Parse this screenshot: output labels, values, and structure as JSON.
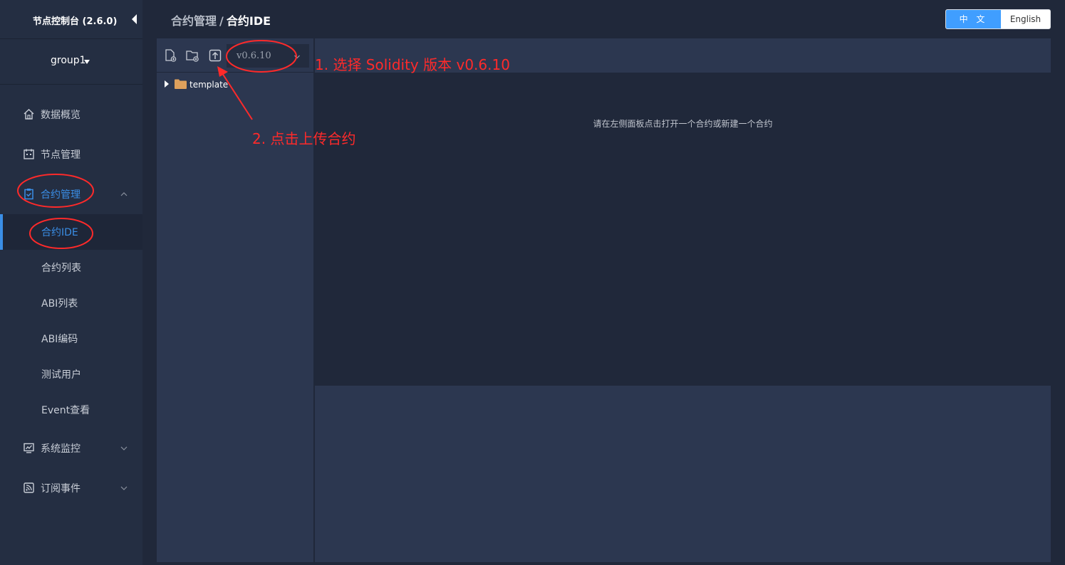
{
  "sidebar": {
    "brand_title": "节点控制台 (2.6.0)",
    "group_label": "group1",
    "menu": {
      "overview": "数据概览",
      "node": "节点管理",
      "contract": "合约管理",
      "monitor": "系统监控",
      "subscribe": "订阅事件"
    },
    "submenu": {
      "ide": "合约IDE",
      "list": "合约列表",
      "abi_list": "ABI列表",
      "abi_encode": "ABI编码",
      "test_user": "测试用户",
      "event": "Event查看"
    }
  },
  "header": {
    "breadcrumb_parent": "合约管理",
    "breadcrumb_sep": "/",
    "breadcrumb_current": "合约IDE",
    "lang_zh": "中 文",
    "lang_en": "English"
  },
  "file_panel": {
    "version": "v0.6.10",
    "tree": [
      {
        "label": "template",
        "type": "folder",
        "expanded": false
      }
    ]
  },
  "editor": {
    "hint": "请在左侧面板点击打开一个合约或新建一个合约"
  },
  "annotations": {
    "step1": "1. 选择 Solidity 版本 v0.6.10",
    "step2": "2. 点击上传合约"
  },
  "colors": {
    "accent": "#3a8ee6",
    "lang_active": "#409eff",
    "annotation": "#ff2a2a",
    "sidebar_bg": "#242e42",
    "page_bg": "#20283a",
    "panel_bg": "#2c3750"
  }
}
